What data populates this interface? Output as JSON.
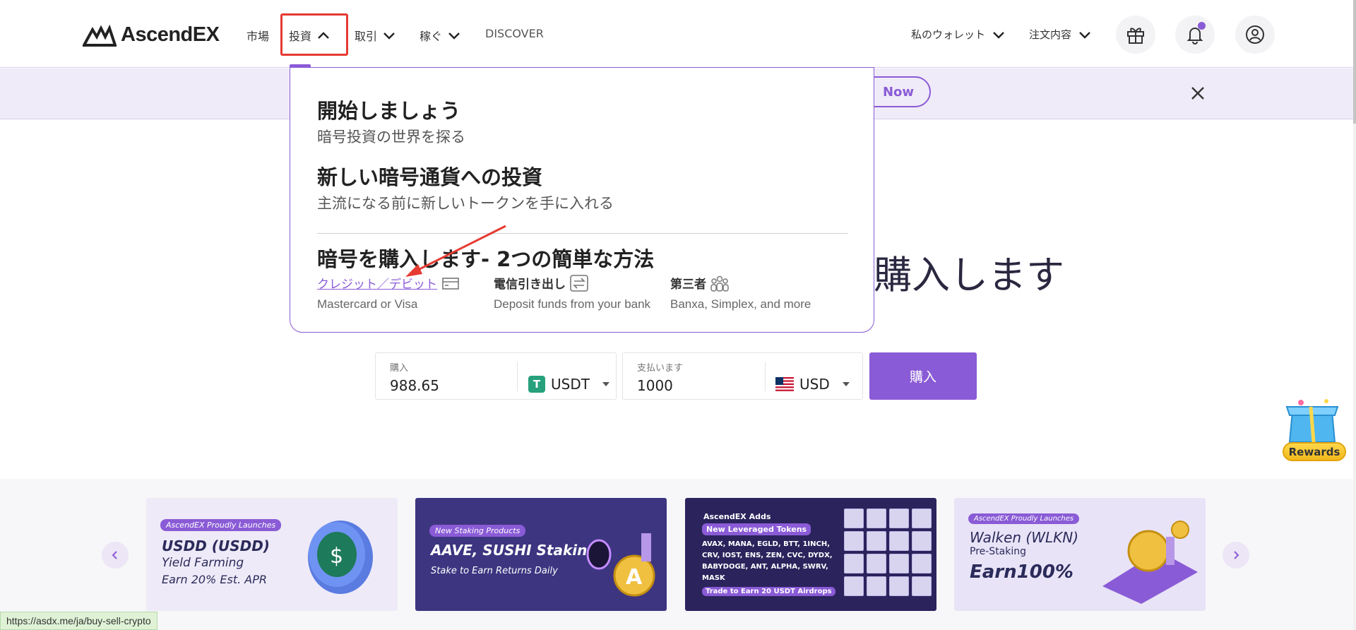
{
  "brand": {
    "name": "AscendEX"
  },
  "nav": {
    "markets": "市場",
    "invest": "投資",
    "trade": "取引",
    "earn": "稼ぐ",
    "discover": "DISCOVER"
  },
  "header_right": {
    "wallet": "私のウォレット",
    "orders": "注文内容"
  },
  "banner": {
    "pill_label": "Now"
  },
  "dropdown": {
    "section1_title": "開始しましょう",
    "section1_sub": "暗号投資の世界を探る",
    "section2_title": "新しい暗号通貨への投資",
    "section2_sub": "主流になる前に新しいトークンを手に入れる",
    "section3_title": "暗号を購入します- 2つの簡単な方法",
    "methods": [
      {
        "title": "クレジット／デビット",
        "desc": "Mastercard or Visa"
      },
      {
        "title": "電信引き出し",
        "desc": "Deposit funds from your bank"
      },
      {
        "title": "第三者",
        "desc": "Banxa, Simplex, and more"
      }
    ]
  },
  "hero": {
    "title_visible": "購入します"
  },
  "buy_form": {
    "buy_label": "購入",
    "buy_amount": "988.65",
    "buy_currency": "USDT",
    "pay_label": "支払います",
    "pay_amount": "1000",
    "pay_currency": "USD",
    "submit_label": "購入"
  },
  "rewards": {
    "label": "Rewards"
  },
  "promo_cards": [
    {
      "tag": "AscendEX Proudly Launches",
      "title": "USDD (USDD)",
      "line1": "Yield Farming",
      "line2": "Earn 20% Est. APR"
    },
    {
      "tag": "New Staking Products",
      "title": "AAVE, SUSHI Staking",
      "line1": "Stake to Earn Returns Daily",
      "line2": ""
    },
    {
      "tag": "AscendEX Adds",
      "title": "New Leveraged Tokens",
      "line1": "AVAX, MANA, EGLD, BTT, 1INCH, CRV, IOST, ENS, ZEN, CVC, DYDX, BABYDOGE, ANT, ALPHA, SWRV, MASK",
      "line2": "Trade to Earn 20 USDT Airdrops"
    },
    {
      "tag": "AscendEX Proudly Launches",
      "title": "Walken (WLKN)",
      "line1": "Pre-Staking",
      "line2": "Earn100%"
    }
  ],
  "status_bar": {
    "url": "https://asdx.me/ja/buy-sell-crypto"
  },
  "colors": {
    "accent": "#8a5bd6",
    "highlight": "#e63a32",
    "usdt": "#26a17b"
  }
}
